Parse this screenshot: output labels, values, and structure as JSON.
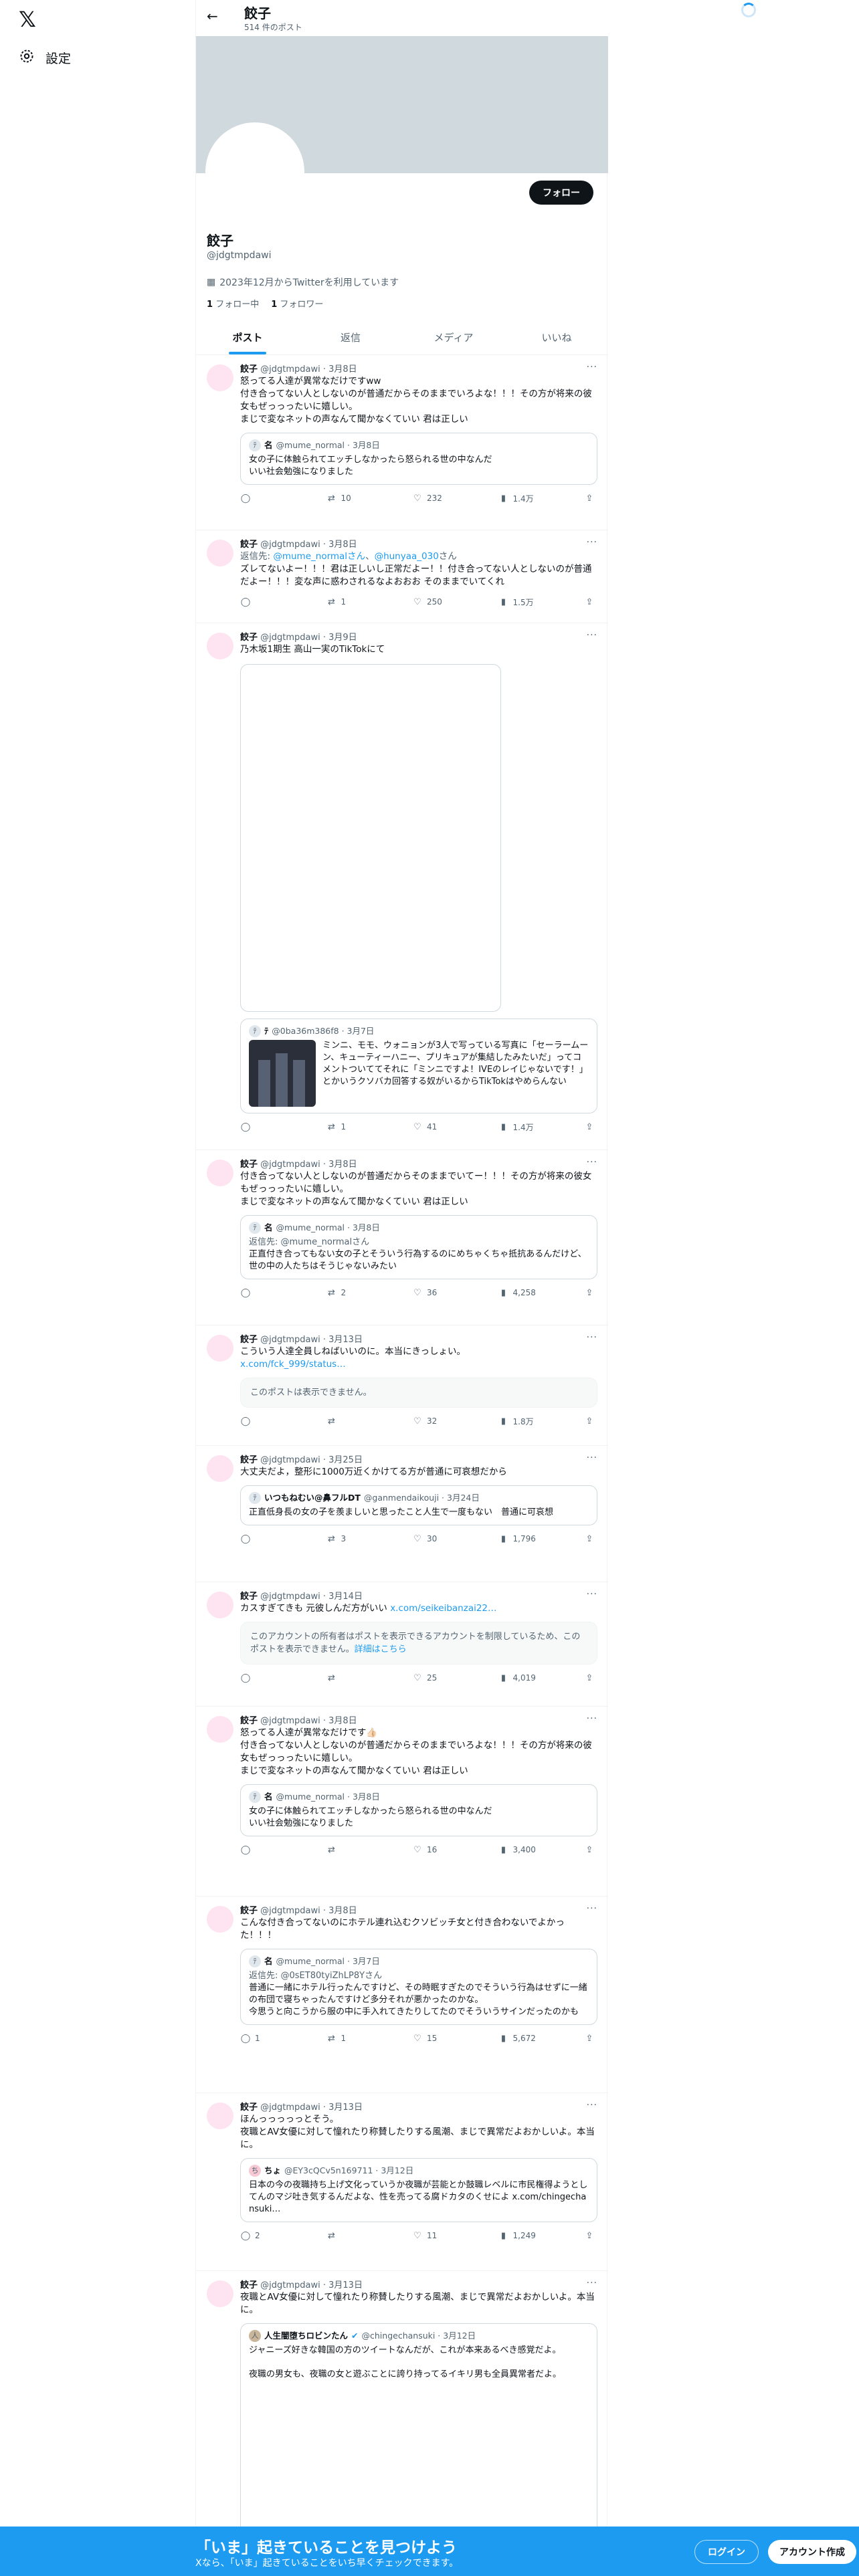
{
  "nav": {
    "logo": "𝕏",
    "settings_label": "設定",
    "settings_icon": "gear-icon"
  },
  "header": {
    "name": "餃子",
    "post_count": "514 件のポスト"
  },
  "profile": {
    "name": "餃子",
    "handle": "@jdgtmpdawi",
    "joined": "2023年12月からTwitterを利用しています",
    "following_count": "1",
    "following_label": "フォロー中",
    "followers_count": "1",
    "followers_label": "フォロワー",
    "follow_button": "フォロー"
  },
  "tabs": [
    "ポスト",
    "返信",
    "メディア",
    "いいね"
  ],
  "posts": [
    {
      "name": "餃子",
      "handle": "@jdgtmpdawi · 3月8日",
      "text": "怒ってる人達が異常なだけですww\n付き合ってない人としないのが普通だからそのままでいろよな！！！その方が将来の彼女もぜっっったいに嬉しい。\nまじで変なネットの声なんて聞かなくていい 君は正しい",
      "quote": {
        "name": "名",
        "handle": "@mume_normal · 3月8日",
        "text": "女の子に体触られてエッチしなかったら怒られる世の中なんだ\nいい社会勉強になりました"
      },
      "stats": {
        "reply": "",
        "retweet": "10",
        "like": "232",
        "views": "1.4万"
      }
    },
    {
      "name": "餃子",
      "handle": "@jdgtmpdawi · 3月8日",
      "reply_to_prefix": "返信先: ",
      "reply_to": "@mume_normalさん",
      "reply_to_2": "@hunyaa_030",
      "reply_to_suffix": "さん",
      "text": "ズレてないよー！！！君は正しいし正常だよー！！付き合ってない人としないのが普通だよー！！！変な声に惑わされるなよおおお そのままでいてくれ",
      "stats": {
        "reply": "",
        "retweet": "1",
        "like": "250",
        "views": "1.5万"
      }
    },
    {
      "name": "餃子",
      "handle": "@jdgtmpdawi · 3月9日",
      "text": "乃木坂1期生 高山一実のTikTokにて",
      "quote": {
        "name": "ﾃ",
        "handle": "@0ba36m386f8 · 3月7日",
        "text": "ミンニ、モモ、ウォニョンが3人で写っている写真に「セーラームーン、キューティーハニー、プリキュアが集結したみたいだ」ってコメントついててそれに「ミンニですよ！IVEのレイじゃないです！」とかいうクソバカ回答する奴がいるからTikTokはやめらんない"
      },
      "stats": {
        "reply": "",
        "retweet": "1",
        "like": "41",
        "views": "1.4万"
      }
    },
    {
      "name": "餃子",
      "handle": "@jdgtmpdawi · 3月8日",
      "text": "付き合ってない人としないのが普通だからそのままでいてー！！！その方が将来の彼女もぜっっったいに嬉しい。\nまじで変なネットの声なんて聞かなくていい 君は正しい",
      "quote": {
        "name": "名",
        "handle": "@mume_normal · 3月8日",
        "reply_to": "返信先: @mume_normalさん",
        "text": "正直付き合ってもない女の子とそういう行為するのにめちゃくちゃ抵抗あるんだけど、世の中の人たちはそうじゃないみたい"
      },
      "stats": {
        "reply": "",
        "retweet": "2",
        "like": "36",
        "views": "4,258"
      }
    },
    {
      "name": "餃子",
      "handle": "@jdgtmpdawi · 3月13日",
      "text": "こういう人達全員しねばいいのに。本当にきっしょい。",
      "link": "x.com/fck_999/status…",
      "unavailable": "このポストは表示できません。",
      "stats": {
        "reply": "",
        "retweet": "",
        "like": "32",
        "views": "1.8万"
      }
    },
    {
      "name": "餃子",
      "handle": "@jdgtmpdawi · 3月25日",
      "text": "大丈夫だよ，整形に1000万近くかけてる方が普通に可哀想だから",
      "quote": {
        "name": "いつもねむい@鼻フルDT",
        "handle": "@ganmendaikouji · 3月24日",
        "text": "正直低身長の女の子を羨ましいと思ったこと人生で一度もない　普通に可哀想"
      },
      "stats": {
        "reply": "",
        "retweet": "3",
        "like": "30",
        "views": "1,796"
      }
    },
    {
      "name": "餃子",
      "handle": "@jdgtmpdawi · 3月14日",
      "text": "カスすぎてきも 元彼しんだ方がいい ",
      "link": "x.com/seikeibanzai22…",
      "unavailable": "このアカウントの所有者はポストを表示できるアカウントを制限しているため、このポストを表示できません。",
      "unavailable_link": "詳細はこちら",
      "stats": {
        "reply": "",
        "retweet": "",
        "like": "25",
        "views": "4,019"
      }
    },
    {
      "name": "餃子",
      "handle": "@jdgtmpdawi · 3月8日",
      "text": "怒ってる人達が異常なだけです👍🏻\n付き合ってない人としないのが普通だからそのままでいろよな！！！その方が将来の彼女もぜっっったいに嬉しい。\nまじで変なネットの声なんて聞かなくていい 君は正しい",
      "quote": {
        "name": "名",
        "handle": "@mume_normal · 3月8日",
        "text": "女の子に体触られてエッチしなかったら怒られる世の中なんだ\nいい社会勉強になりました"
      },
      "stats": {
        "reply": "",
        "retweet": "",
        "like": "16",
        "views": "3,400"
      }
    },
    {
      "name": "餃子",
      "handle": "@jdgtmpdawi · 3月8日",
      "text": "こんな付き合ってないのにホテル連れ込むクソビッチ女と付き合わないでよかった！！！",
      "quote": {
        "name": "名",
        "handle": "@mume_normal · 3月7日",
        "reply_to": "返信先: @0sET80tyiZhLP8Yさん",
        "text": "普通に一緒にホテル行ったんですけど、その時眠すぎたのでそういう行為はせずに一緒の布団で寝ちゃったんですけど多分それが悪かったのかな。\n今思うと向こうから服の中に手入れてきたりしてたのでそういうサインだったのかも"
      },
      "stats": {
        "reply": "1",
        "retweet": "1",
        "like": "15",
        "views": "5,672"
      }
    },
    {
      "name": "餃子",
      "handle": "@jdgtmpdawi · 3月13日",
      "text": "ほんっっっっっとそう。\n夜職とAV女優に対して憧れたり称賛したりする風潮、まじで異常だよおかしいよ。本当に。",
      "quote": {
        "name": "ちょ",
        "handle": "@EY3cQCv5n169711 · 3月12日",
        "text": "日本の今の夜職持ち上げ文化っていうか夜職が芸能とか鼓職レベルに市民権得ようとしてんのマジ吐き気するんだよな、性を売ってる腐ドカタのくせによ x.com/chingechansuki…"
      },
      "stats": {
        "reply": "2",
        "retweet": "",
        "like": "11",
        "views": "1,249"
      }
    },
    {
      "name": "餃子",
      "handle": "@jdgtmpdawi · 3月13日",
      "text": "夜職とAV女優に対して憧れたり称賛したりする風潮、まじで異常だよおかしいよ。本当に。",
      "quote": {
        "name": "人生闇堕ちロビンたん",
        "handle": "@chingechansuki · 3月12日",
        "text": "ジャニーズ好きな韓国の方のツイートなんだが、これが本来あるべき感覚だよ。\n\n夜職の男女も、夜職の女と遊ぶことに誇り持ってるイキリ男も全員異常者だよ。"
      },
      "stats": {
        "reply": "",
        "retweet": "",
        "like": "",
        "views": ""
      }
    }
  ],
  "bottom_bar": {
    "title": "「いま」起きていることを見つけよう",
    "subtitle": "Xなら、「いま」起きていることをいち早くチェックできます。",
    "login": "ログイン",
    "signup": "アカウント作成"
  }
}
